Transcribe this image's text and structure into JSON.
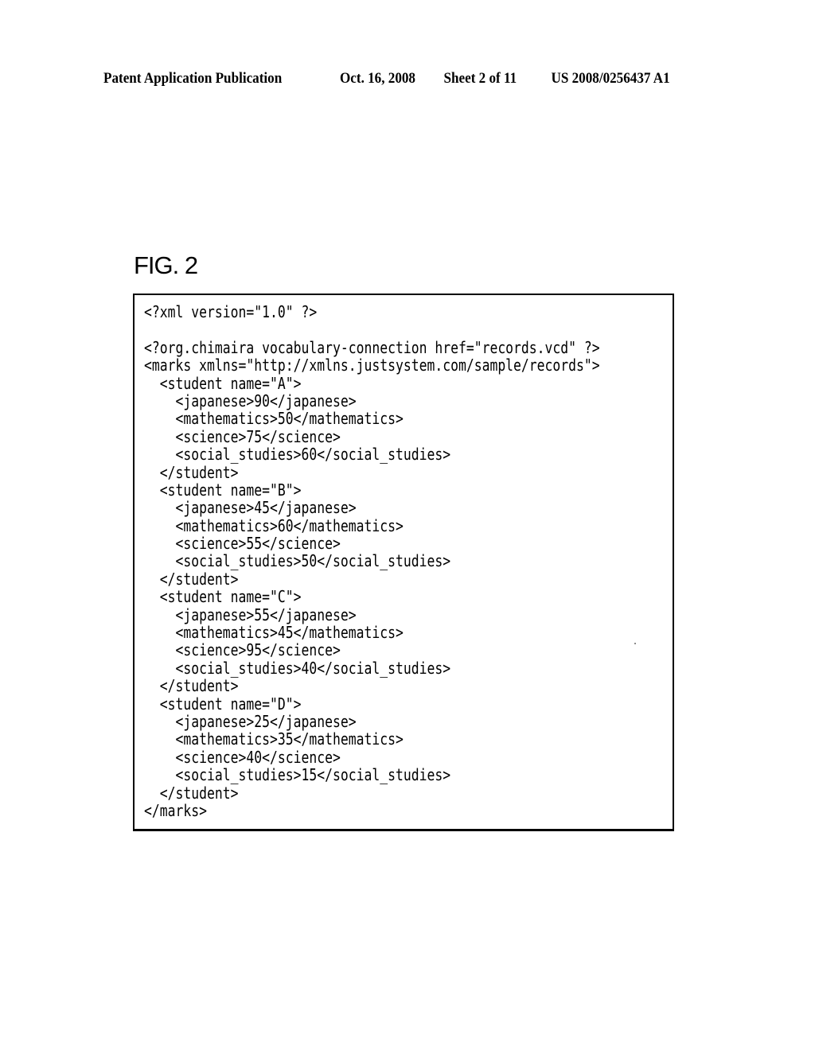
{
  "header": {
    "publication": "Patent Application Publication",
    "date": "Oct. 16, 2008",
    "sheet": "Sheet 2 of 11",
    "number": "US 2008/0256437 A1"
  },
  "figure": {
    "label": "FIG. 2"
  },
  "code_lines": [
    "<?xml version=\"1.0\" ?>",
    "",
    "<?org.chimaira vocabulary-connection href=\"records.vcd\" ?>",
    "<marks xmlns=\"http://xmlns.justsystem.com/sample/records\">",
    "  <student name=\"A\">",
    "    <japanese>90</japanese>",
    "    <mathematics>50</mathematics>",
    "    <science>75</science>",
    "    <social_studies>60</social_studies>",
    "  </student>",
    "  <student name=\"B\">",
    "    <japanese>45</japanese>",
    "    <mathematics>60</mathematics>",
    "    <science>55</science>",
    "    <social_studies>50</social_studies>",
    "  </student>",
    "  <student name=\"C\">",
    "    <japanese>55</japanese>",
    "    <mathematics>45</mathematics>",
    "    <science>95</science>",
    "    <social_studies>40</social_studies>",
    "  </student>",
    "  <student name=\"D\">",
    "    <japanese>25</japanese>",
    "    <mathematics>35</mathematics>",
    "    <science>40</science>",
    "    <social_studies>15</social_studies>",
    "  </student>",
    "</marks>"
  ]
}
